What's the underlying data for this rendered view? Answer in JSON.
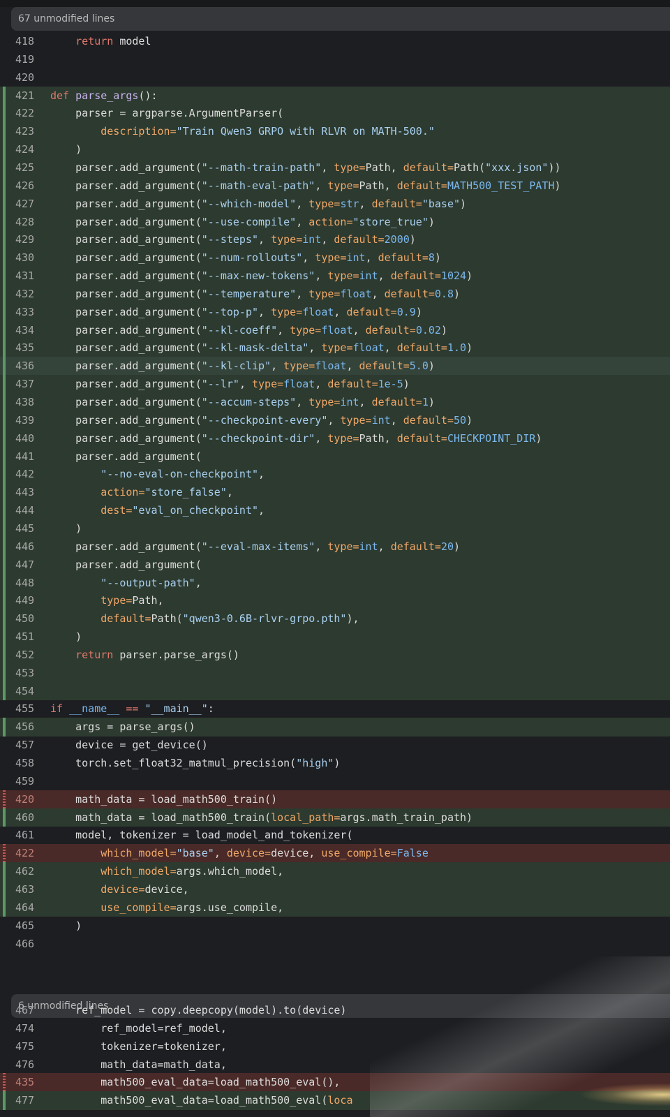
{
  "collapsed": [
    {
      "label": "67 unmodified lines"
    },
    {
      "label": "6 unmodified lines"
    }
  ],
  "lines": [
    {
      "num": "418",
      "type": "ctx",
      "tokens": [
        [
          "",
          "    "
        ],
        [
          "k",
          "return"
        ],
        [
          "",
          " model"
        ]
      ]
    },
    {
      "num": "419",
      "type": "ctx",
      "tokens": []
    },
    {
      "num": "420",
      "type": "ctx",
      "tokens": []
    },
    {
      "num": "421",
      "type": "add",
      "tokens": [
        [
          "k",
          "def"
        ],
        [
          "",
          " "
        ],
        [
          "f",
          "parse_args"
        ],
        [
          "",
          "():"
        ]
      ]
    },
    {
      "num": "422",
      "type": "add",
      "tokens": [
        [
          "",
          "    parser = argparse.ArgumentParser("
        ]
      ]
    },
    {
      "num": "423",
      "type": "add",
      "tokens": [
        [
          "",
          "        "
        ],
        [
          "p",
          "description="
        ],
        [
          "s",
          "\"Train Qwen3 GRPO with RLVR on MATH-500.\""
        ]
      ]
    },
    {
      "num": "424",
      "type": "add",
      "tokens": [
        [
          "",
          "    )"
        ]
      ]
    },
    {
      "num": "425",
      "type": "add",
      "tokens": [
        [
          "",
          "    parser.add_argument("
        ],
        [
          "s",
          "\"--math-train-path\""
        ],
        [
          "",
          ", "
        ],
        [
          "p",
          "type="
        ],
        [
          "",
          "Path, "
        ],
        [
          "p",
          "default="
        ],
        [
          "",
          "Path("
        ],
        [
          "s",
          "\"xxx.json\""
        ],
        [
          "",
          "))"
        ]
      ]
    },
    {
      "num": "426",
      "type": "add",
      "tokens": [
        [
          "",
          "    parser.add_argument("
        ],
        [
          "s",
          "\"--math-eval-path\""
        ],
        [
          "",
          ", "
        ],
        [
          "p",
          "type="
        ],
        [
          "",
          "Path, "
        ],
        [
          "p",
          "default="
        ],
        [
          "n",
          "MATH500_TEST_PATH"
        ],
        [
          "",
          ")"
        ]
      ]
    },
    {
      "num": "427",
      "type": "add",
      "tokens": [
        [
          "",
          "    parser.add_argument("
        ],
        [
          "s",
          "\"--which-model\""
        ],
        [
          "",
          ", "
        ],
        [
          "p",
          "type="
        ],
        [
          "n",
          "str"
        ],
        [
          "",
          ", "
        ],
        [
          "p",
          "default="
        ],
        [
          "s",
          "\"base\""
        ],
        [
          "",
          ")"
        ]
      ]
    },
    {
      "num": "428",
      "type": "add",
      "tokens": [
        [
          "",
          "    parser.add_argument("
        ],
        [
          "s",
          "\"--use-compile\""
        ],
        [
          "",
          ", "
        ],
        [
          "p",
          "action="
        ],
        [
          "s",
          "\"store_true\""
        ],
        [
          "",
          ")"
        ]
      ]
    },
    {
      "num": "429",
      "type": "add",
      "tokens": [
        [
          "",
          "    parser.add_argument("
        ],
        [
          "s",
          "\"--steps\""
        ],
        [
          "",
          ", "
        ],
        [
          "p",
          "type="
        ],
        [
          "n",
          "int"
        ],
        [
          "",
          ", "
        ],
        [
          "p",
          "default="
        ],
        [
          "n",
          "2000"
        ],
        [
          "",
          ")"
        ]
      ]
    },
    {
      "num": "430",
      "type": "add",
      "tokens": [
        [
          "",
          "    parser.add_argument("
        ],
        [
          "s",
          "\"--num-rollouts\""
        ],
        [
          "",
          ", "
        ],
        [
          "p",
          "type="
        ],
        [
          "n",
          "int"
        ],
        [
          "",
          ", "
        ],
        [
          "p",
          "default="
        ],
        [
          "n",
          "8"
        ],
        [
          "",
          ")"
        ]
      ]
    },
    {
      "num": "431",
      "type": "add",
      "tokens": [
        [
          "",
          "    parser.add_argument("
        ],
        [
          "s",
          "\"--max-new-tokens\""
        ],
        [
          "",
          ", "
        ],
        [
          "p",
          "type="
        ],
        [
          "n",
          "int"
        ],
        [
          "",
          ", "
        ],
        [
          "p",
          "default="
        ],
        [
          "n",
          "1024"
        ],
        [
          "",
          ")"
        ]
      ]
    },
    {
      "num": "432",
      "type": "add",
      "tokens": [
        [
          "",
          "    parser.add_argument("
        ],
        [
          "s",
          "\"--temperature\""
        ],
        [
          "",
          ", "
        ],
        [
          "p",
          "type="
        ],
        [
          "n",
          "float"
        ],
        [
          "",
          ", "
        ],
        [
          "p",
          "default="
        ],
        [
          "n",
          "0.8"
        ],
        [
          "",
          ")"
        ]
      ]
    },
    {
      "num": "433",
      "type": "add",
      "tokens": [
        [
          "",
          "    parser.add_argument("
        ],
        [
          "s",
          "\"--top-p\""
        ],
        [
          "",
          ", "
        ],
        [
          "p",
          "type="
        ],
        [
          "n",
          "float"
        ],
        [
          "",
          ", "
        ],
        [
          "p",
          "default="
        ],
        [
          "n",
          "0.9"
        ],
        [
          "",
          ")"
        ]
      ]
    },
    {
      "num": "434",
      "type": "add",
      "tokens": [
        [
          "",
          "    parser.add_argument("
        ],
        [
          "s",
          "\"--kl-coeff\""
        ],
        [
          "",
          ", "
        ],
        [
          "p",
          "type="
        ],
        [
          "n",
          "float"
        ],
        [
          "",
          ", "
        ],
        [
          "p",
          "default="
        ],
        [
          "n",
          "0.02"
        ],
        [
          "",
          ")"
        ]
      ]
    },
    {
      "num": "435",
      "type": "add",
      "tokens": [
        [
          "",
          "    parser.add_argument("
        ],
        [
          "s",
          "\"--kl-mask-delta\""
        ],
        [
          "",
          ", "
        ],
        [
          "p",
          "type="
        ],
        [
          "n",
          "float"
        ],
        [
          "",
          ", "
        ],
        [
          "p",
          "default="
        ],
        [
          "n",
          "1.0"
        ],
        [
          "",
          ")"
        ]
      ]
    },
    {
      "num": "436",
      "type": "add",
      "hl": true,
      "tokens": [
        [
          "",
          "    parser.add_argument("
        ],
        [
          "s",
          "\"--kl-clip\""
        ],
        [
          "",
          ", "
        ],
        [
          "p",
          "type="
        ],
        [
          "n",
          "float"
        ],
        [
          "",
          ", "
        ],
        [
          "p",
          "default="
        ],
        [
          "n",
          "5.0"
        ],
        [
          "",
          ")"
        ]
      ]
    },
    {
      "num": "437",
      "type": "add",
      "tokens": [
        [
          "",
          "    parser.add_argument("
        ],
        [
          "s",
          "\"--lr\""
        ],
        [
          "",
          ", "
        ],
        [
          "p",
          "type="
        ],
        [
          "n",
          "float"
        ],
        [
          "",
          ", "
        ],
        [
          "p",
          "default="
        ],
        [
          "n",
          "1e-5"
        ],
        [
          "",
          ")"
        ]
      ]
    },
    {
      "num": "438",
      "type": "add",
      "tokens": [
        [
          "",
          "    parser.add_argument("
        ],
        [
          "s",
          "\"--accum-steps\""
        ],
        [
          "",
          ", "
        ],
        [
          "p",
          "type="
        ],
        [
          "n",
          "int"
        ],
        [
          "",
          ", "
        ],
        [
          "p",
          "default="
        ],
        [
          "n",
          "1"
        ],
        [
          "",
          ")"
        ]
      ]
    },
    {
      "num": "439",
      "type": "add",
      "tokens": [
        [
          "",
          "    parser.add_argument("
        ],
        [
          "s",
          "\"--checkpoint-every\""
        ],
        [
          "",
          ", "
        ],
        [
          "p",
          "type="
        ],
        [
          "n",
          "int"
        ],
        [
          "",
          ", "
        ],
        [
          "p",
          "default="
        ],
        [
          "n",
          "50"
        ],
        [
          "",
          ")"
        ]
      ]
    },
    {
      "num": "440",
      "type": "add",
      "tokens": [
        [
          "",
          "    parser.add_argument("
        ],
        [
          "s",
          "\"--checkpoint-dir\""
        ],
        [
          "",
          ", "
        ],
        [
          "p",
          "type="
        ],
        [
          "",
          "Path, "
        ],
        [
          "p",
          "default="
        ],
        [
          "n",
          "CHECKPOINT_DIR"
        ],
        [
          "",
          ")"
        ]
      ]
    },
    {
      "num": "441",
      "type": "add",
      "tokens": [
        [
          "",
          "    parser.add_argument("
        ]
      ]
    },
    {
      "num": "442",
      "type": "add",
      "tokens": [
        [
          "",
          "        "
        ],
        [
          "s",
          "\"--no-eval-on-checkpoint\""
        ],
        [
          "",
          ","
        ]
      ]
    },
    {
      "num": "443",
      "type": "add",
      "tokens": [
        [
          "",
          "        "
        ],
        [
          "p",
          "action="
        ],
        [
          "s",
          "\"store_false\""
        ],
        [
          "",
          ","
        ]
      ]
    },
    {
      "num": "444",
      "type": "add",
      "tokens": [
        [
          "",
          "        "
        ],
        [
          "p",
          "dest="
        ],
        [
          "s",
          "\"eval_on_checkpoint\""
        ],
        [
          "",
          ","
        ]
      ]
    },
    {
      "num": "445",
      "type": "add",
      "tokens": [
        [
          "",
          "    )"
        ]
      ]
    },
    {
      "num": "446",
      "type": "add",
      "tokens": [
        [
          "",
          "    parser.add_argument("
        ],
        [
          "s",
          "\"--eval-max-items\""
        ],
        [
          "",
          ", "
        ],
        [
          "p",
          "type="
        ],
        [
          "n",
          "int"
        ],
        [
          "",
          ", "
        ],
        [
          "p",
          "default="
        ],
        [
          "n",
          "20"
        ],
        [
          "",
          ")"
        ]
      ]
    },
    {
      "num": "447",
      "type": "add",
      "tokens": [
        [
          "",
          "    parser.add_argument("
        ]
      ]
    },
    {
      "num": "448",
      "type": "add",
      "tokens": [
        [
          "",
          "        "
        ],
        [
          "s",
          "\"--output-path\""
        ],
        [
          "",
          ","
        ]
      ]
    },
    {
      "num": "449",
      "type": "add",
      "tokens": [
        [
          "",
          "        "
        ],
        [
          "p",
          "type="
        ],
        [
          "",
          "Path,"
        ]
      ]
    },
    {
      "num": "450",
      "type": "add",
      "tokens": [
        [
          "",
          "        "
        ],
        [
          "p",
          "default="
        ],
        [
          "",
          "Path("
        ],
        [
          "s",
          "\"qwen3-0.6B-rlvr-grpo.pth\""
        ],
        [
          "",
          "),"
        ]
      ]
    },
    {
      "num": "451",
      "type": "add",
      "tokens": [
        [
          "",
          "    )"
        ]
      ]
    },
    {
      "num": "452",
      "type": "add",
      "tokens": [
        [
          "",
          "    "
        ],
        [
          "k",
          "return"
        ],
        [
          "",
          " parser.parse_args()"
        ]
      ]
    },
    {
      "num": "453",
      "type": "add",
      "tokens": []
    },
    {
      "num": "454",
      "type": "add",
      "tokens": []
    },
    {
      "num": "455",
      "type": "ctx",
      "tokens": [
        [
          "k",
          "if"
        ],
        [
          "",
          " "
        ],
        [
          "n",
          "__name__"
        ],
        [
          "",
          " "
        ],
        [
          "k",
          "=="
        ],
        [
          "",
          " "
        ],
        [
          "s",
          "\"__main__\""
        ],
        [
          "",
          ":"
        ]
      ]
    },
    {
      "num": "456",
      "type": "add",
      "tokens": [
        [
          "",
          "    args = parse_args()"
        ]
      ]
    },
    {
      "num": "457",
      "type": "ctx",
      "tokens": [
        [
          "",
          "    device = get_device()"
        ]
      ]
    },
    {
      "num": "458",
      "type": "ctx",
      "tokens": [
        [
          "",
          "    torch.set_float32_matmul_precision("
        ],
        [
          "s",
          "\"high\""
        ],
        [
          "",
          ")"
        ]
      ]
    },
    {
      "num": "459",
      "type": "ctx",
      "tokens": []
    },
    {
      "num": "420",
      "type": "del",
      "tokens": [
        [
          "",
          "    math_data = load_math500_train()"
        ]
      ]
    },
    {
      "num": "460",
      "type": "add",
      "tokens": [
        [
          "",
          "    math_data = load_math500_train("
        ],
        [
          "p",
          "local_path="
        ],
        [
          "",
          "args.math_train_path)"
        ]
      ]
    },
    {
      "num": "461",
      "type": "ctx",
      "tokens": [
        [
          "",
          "    model, tokenizer = load_model_and_tokenizer("
        ]
      ]
    },
    {
      "num": "422",
      "type": "del",
      "tokens": [
        [
          "",
          "        "
        ],
        [
          "p",
          "which_model="
        ],
        [
          "s",
          "\"base\""
        ],
        [
          "",
          ", "
        ],
        [
          "p",
          "device="
        ],
        [
          "",
          "device, "
        ],
        [
          "p",
          "use_compile="
        ],
        [
          "n",
          "False"
        ]
      ]
    },
    {
      "num": "462",
      "type": "add",
      "tokens": [
        [
          "",
          "        "
        ],
        [
          "p",
          "which_model="
        ],
        [
          "",
          "args.which_model,"
        ]
      ]
    },
    {
      "num": "463",
      "type": "add",
      "tokens": [
        [
          "",
          "        "
        ],
        [
          "p",
          "device="
        ],
        [
          "",
          "device,"
        ]
      ]
    },
    {
      "num": "464",
      "type": "add",
      "tokens": [
        [
          "",
          "        "
        ],
        [
          "p",
          "use_compile="
        ],
        [
          "",
          "args.use_compile,"
        ]
      ]
    },
    {
      "num": "465",
      "type": "ctx",
      "tokens": [
        [
          "",
          "    )"
        ]
      ]
    },
    {
      "num": "466",
      "type": "ctx",
      "tokens": []
    },
    {
      "num": "467",
      "type": "ctx",
      "tokens": [
        [
          "",
          "    ref_model = copy.deepcopy(model).to(device)"
        ]
      ]
    },
    {
      "num": "474",
      "type": "ctx",
      "tokens": [
        [
          "",
          "        ref_model=ref_model,"
        ]
      ]
    },
    {
      "num": "475",
      "type": "ctx",
      "tokens": [
        [
          "",
          "        tokenizer=tokenizer,"
        ]
      ]
    },
    {
      "num": "476",
      "type": "ctx",
      "tokens": [
        [
          "",
          "        math_data=math_data,"
        ]
      ]
    },
    {
      "num": "435",
      "type": "del",
      "tokens": [
        [
          "",
          "        math500_eval_data=load_math500_eval(),"
        ]
      ]
    },
    {
      "num": "477",
      "type": "add",
      "tokens": [
        [
          "",
          "        math500_eval_data=load_math500_eval("
        ],
        [
          "p",
          "loca"
        ]
      ]
    }
  ]
}
